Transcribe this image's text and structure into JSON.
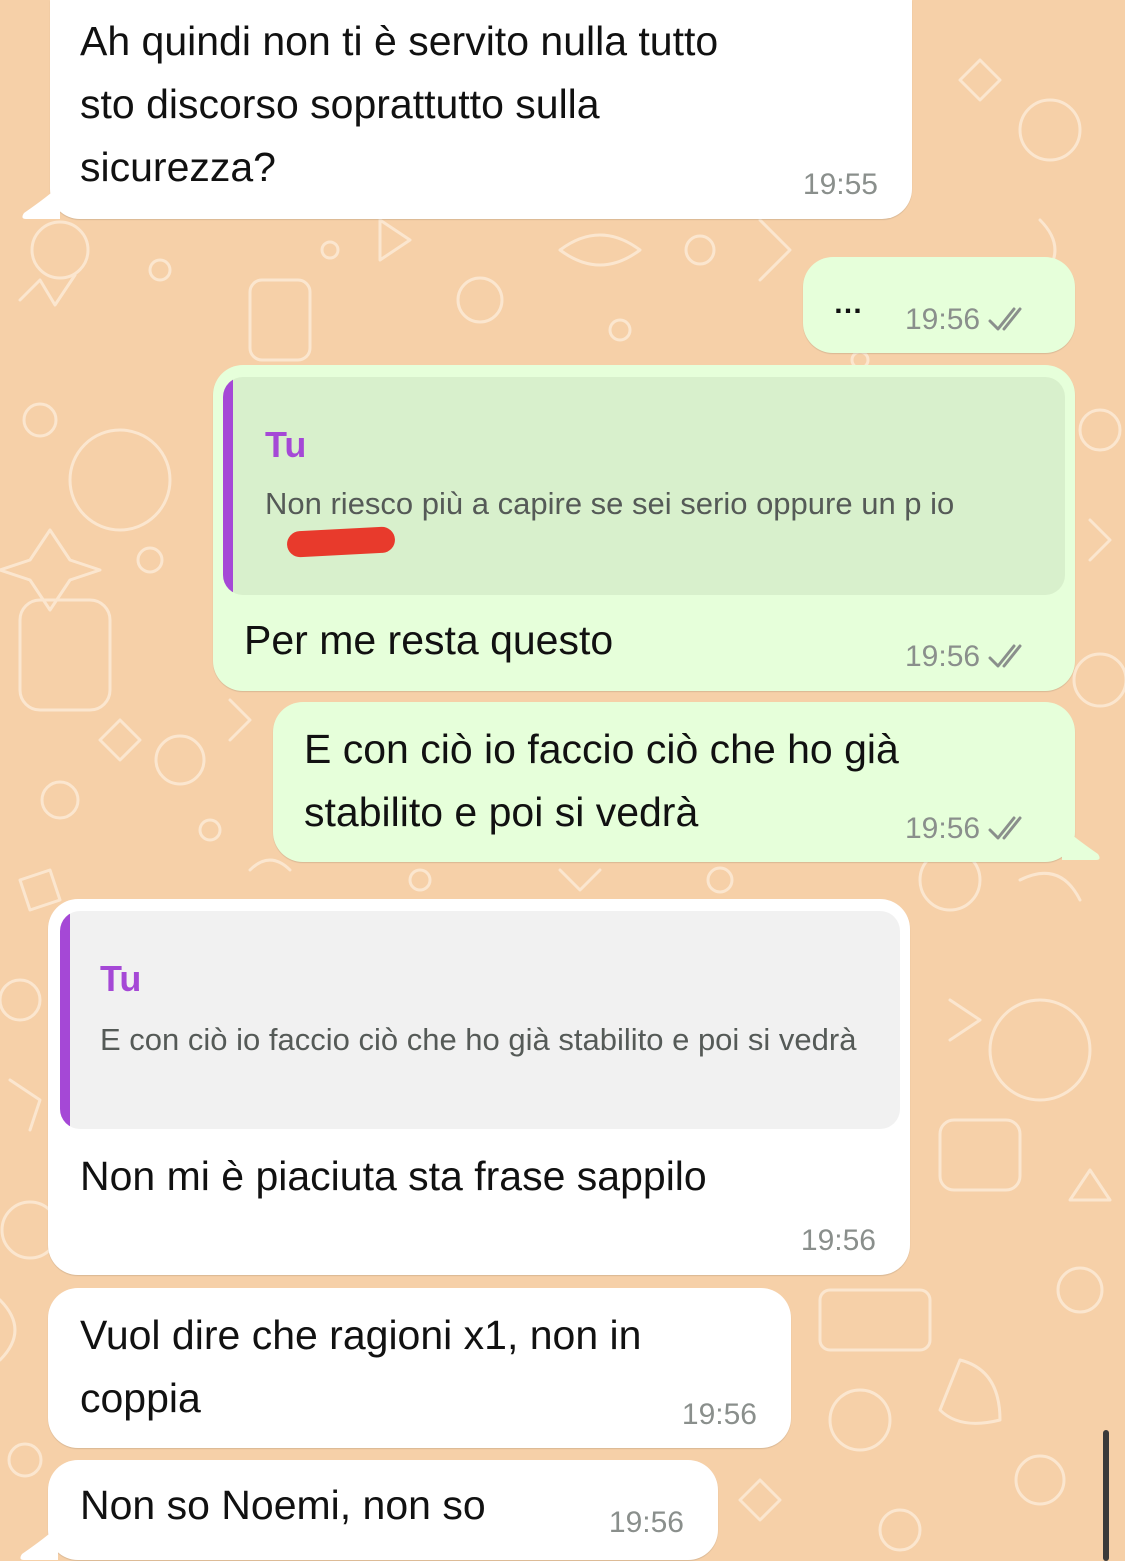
{
  "messages": [
    {
      "direction": "incoming",
      "text": "Ah quindi non ti è servito nulla tutto\nsto discorso soprattutto sulla\nsicurezza?",
      "time": "19:55"
    },
    {
      "direction": "outgoing",
      "text": "…",
      "time": "19:56",
      "status": "read"
    },
    {
      "direction": "outgoing",
      "quote": {
        "author": "Tu",
        "text": "Non riesco più a capire se sei serio oppure un\np      io"
      },
      "text": "Per me resta questo",
      "time": "19:56",
      "status": "read"
    },
    {
      "direction": "outgoing",
      "text": "E con ciò io faccio ciò che ho già\nstabilito e poi si vedrà",
      "time": "19:56",
      "status": "read"
    },
    {
      "direction": "incoming",
      "quote": {
        "author": "Tu",
        "text": "E con ciò io faccio ciò che ho già stabilito e\npoi si vedrà"
      },
      "text": "Non mi è piaciuta sta frase sappilo",
      "time": "19:56"
    },
    {
      "direction": "incoming",
      "text": "Vuol dire che ragioni x1, non in\ncoppia",
      "time": "19:56"
    },
    {
      "direction": "incoming",
      "text": "Non so Noemi, non so",
      "time": "19:56"
    }
  ],
  "colors": {
    "wallpaper": "#f6d0a8",
    "incoming_bubble": "#ffffff",
    "outgoing_bubble": "#e6ffda",
    "quote_accent": "#a548d6",
    "redaction": "#e83a2c",
    "meta_text": "#8a8f8c"
  },
  "icons": {
    "read_receipt": "double-check-icon"
  }
}
